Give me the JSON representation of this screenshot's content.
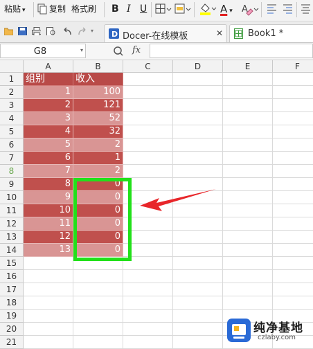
{
  "toolbar": {
    "paste_label": "粘贴",
    "paste_dropdown": "▾",
    "copy_label": "复制",
    "format_painter_label": "格式刷",
    "bold_label": "B",
    "italic_label": "I",
    "underline_label": "U",
    "font_color_letter": "A",
    "icons": [
      "paste-icon",
      "copy-icon",
      "bold-icon",
      "italic-icon",
      "underline-icon",
      "borders-icon",
      "merge-icon",
      "fill-color-icon",
      "font-color-icon",
      "clear-format-icon",
      "align-left-icon",
      "align-center-icon"
    ]
  },
  "tabs": [
    {
      "label": "Docer-在线模板",
      "close": "✕",
      "icon": "docer-icon"
    },
    {
      "label": "Book1 *",
      "icon": "spreadsheet-icon"
    }
  ],
  "formula_bar": {
    "cell_name": "G8",
    "fx_label": "fx",
    "value": ""
  },
  "columns": [
    "A",
    "B",
    "C",
    "D",
    "E",
    "F"
  ],
  "rows": [
    "1",
    "2",
    "3",
    "4",
    "5",
    "6",
    "7",
    "8",
    "9",
    "10",
    "11",
    "12",
    "13",
    "14",
    "15",
    "16",
    "17",
    "18",
    "19",
    "20",
    "21"
  ],
  "table": {
    "header": [
      "组别",
      "收入"
    ],
    "data": [
      [
        "1",
        "100"
      ],
      [
        "2",
        "121"
      ],
      [
        "3",
        "52"
      ],
      [
        "4",
        "32"
      ],
      [
        "5",
        "2"
      ],
      [
        "6",
        "1"
      ],
      [
        "7",
        "2"
      ],
      [
        "8",
        "0"
      ],
      [
        "9",
        "0"
      ],
      [
        "10",
        "0"
      ],
      [
        "11",
        "0"
      ],
      [
        "12",
        "0"
      ],
      [
        "13",
        "0"
      ]
    ]
  },
  "colors": {
    "band_dark": "#c0504d",
    "band_light": "#d99594",
    "header_dark": "#b94a48",
    "highlight_box": "#22e01a",
    "arrow": "#e8262a",
    "selected_row": "#6aa84f"
  },
  "watermark": {
    "text": "纯净基地",
    "url": "czlaby.com"
  }
}
